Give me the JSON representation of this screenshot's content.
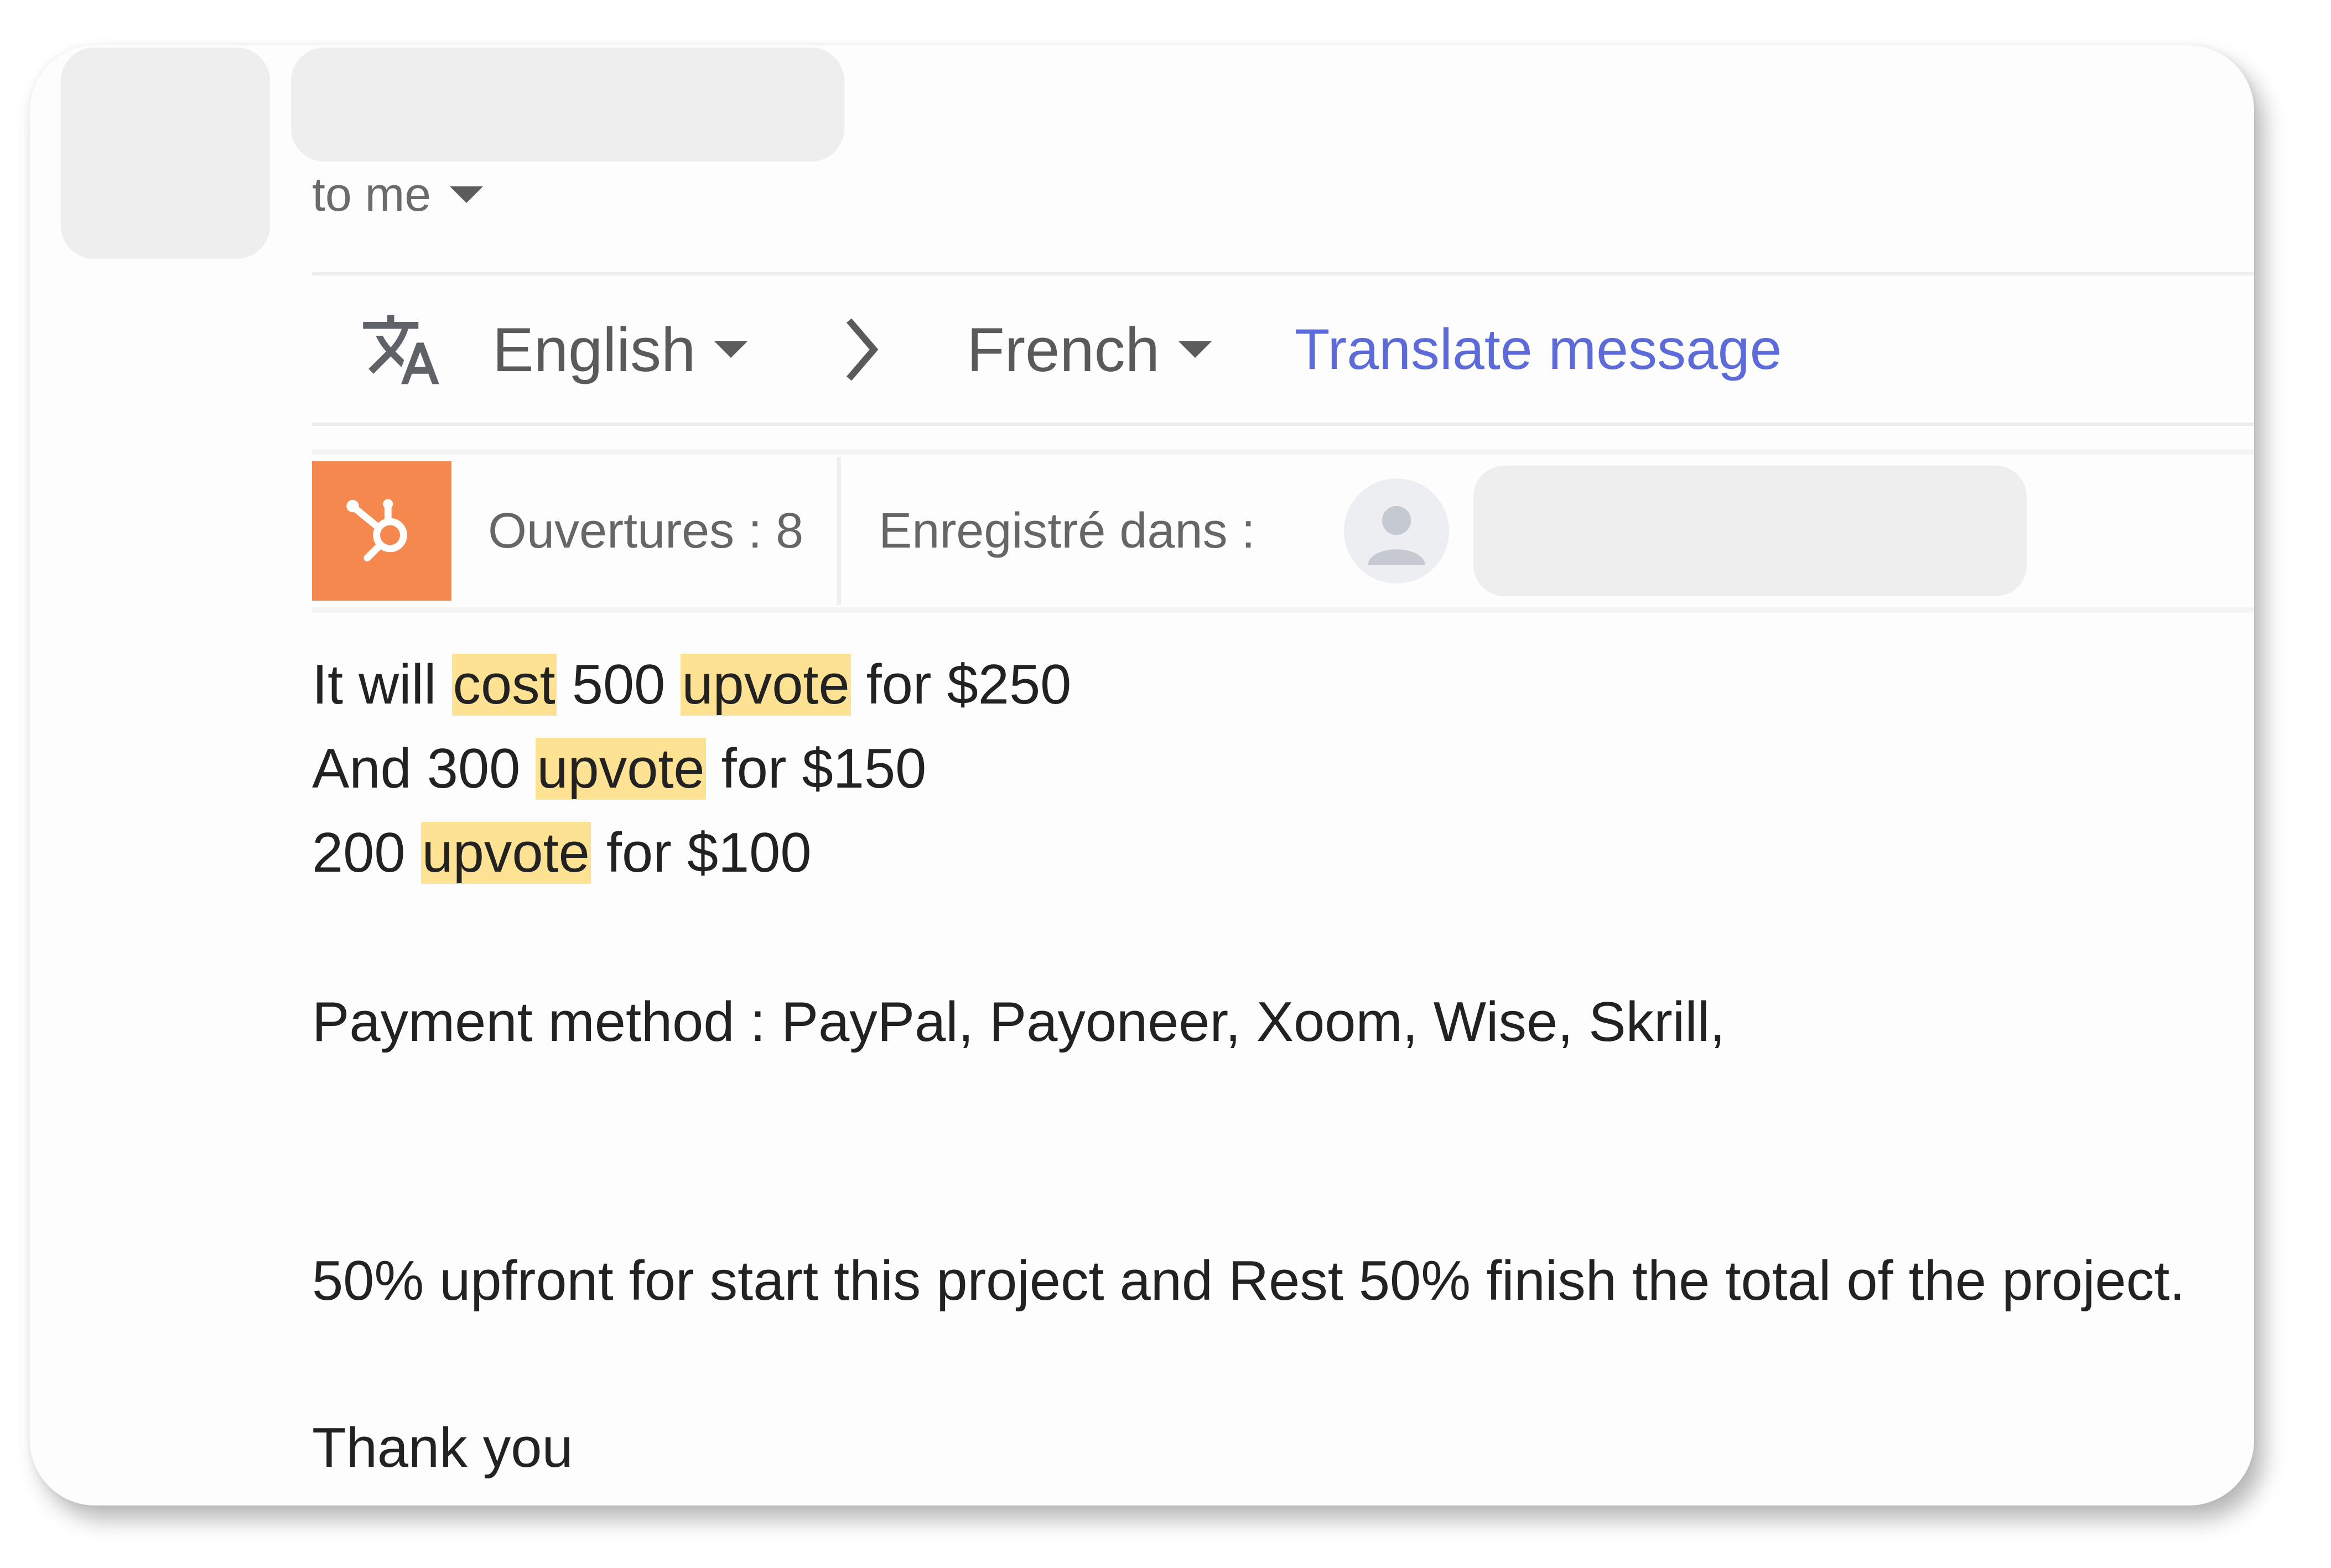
{
  "recipient": {
    "to_label": "to me"
  },
  "translate_bar": {
    "source_language": "English",
    "target_language": "French",
    "translate_link": "Translate message"
  },
  "hubspot_bar": {
    "opens": "Ouvertures : 8",
    "saved_in": "Enregistré dans :",
    "logo_color": "#f4884f"
  },
  "message": {
    "line1": {
      "p1": "It will ",
      "h1": "cost",
      "p2": " 500 ",
      "h2": "upvote",
      "p3": " for $250"
    },
    "line2": {
      "p1": "And 300 ",
      "h1": "upvote",
      "p2": " for $150"
    },
    "line3": {
      "p1": "200 ",
      "h1": "upvote",
      "p2": " for $100"
    },
    "payment": "Payment method : PayPal, Payoneer, Xoom, Wise, Skrill,",
    "terms": "50% upfront for start this project and Rest 50% finish the total of the project.",
    "closing": "Thank you"
  },
  "colors": {
    "highlight": "#fde293",
    "link": "#5c6bd8"
  }
}
